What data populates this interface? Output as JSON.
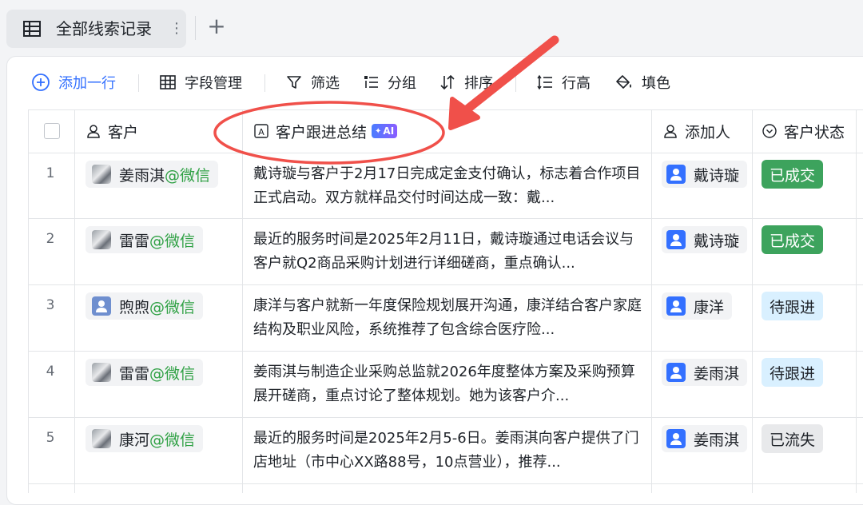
{
  "tab": {
    "label": "全部线索记录",
    "more": "⋮",
    "add": "+"
  },
  "toolbar": {
    "add_row": "添加一行",
    "fields": "字段管理",
    "filter": "筛选",
    "group": "分组",
    "sort": "排序",
    "row_height": "行高",
    "fill": "填色"
  },
  "columns": {
    "customer": "客户",
    "summary": "客户跟进总结",
    "ai_badge": "AI",
    "added_by": "添加人",
    "status": "客户状态"
  },
  "rows": [
    {
      "num": "1",
      "customer": "姜雨淇",
      "channel": "@微信",
      "avatar": "photo",
      "summary": "戴诗璇与客户于2月17日完成定金支付确认，标志着合作项目正式启动。双方就样品交付时间达成一致：戴...",
      "added_by": "戴诗璇",
      "status": "已成交",
      "status_color": "#34a853",
      "status_bg": "#3da35d",
      "status_fg": "#ffffff"
    },
    {
      "num": "2",
      "customer": "雷雷",
      "channel": "@微信",
      "avatar": "photo",
      "summary": "最近的服务时间是2025年2月11日，戴诗璇通过电话会议与客户就Q2商品采购计划进行详细磋商，重点确认...",
      "added_by": "戴诗璇",
      "status": "已成交",
      "status_bg": "#3da35d",
      "status_fg": "#ffffff"
    },
    {
      "num": "3",
      "customer": "煦煦",
      "channel": "@微信",
      "avatar": "user",
      "summary": "康洋与客户就新一年度保险规划展开沟通，康洋结合客户家庭结构及职业风险，系统推荐了包含综合医疗险...",
      "added_by": "康洋",
      "status": "待跟进",
      "status_bg": "#d9f0ff",
      "status_fg": "#1f2329"
    },
    {
      "num": "4",
      "customer": "雷雷",
      "channel": "@微信",
      "avatar": "photo",
      "summary": "姜雨淇与制造企业采购总监就2026年度整体方案及采购预算展开磋商，重点讨论了整体规划。她为该客户介...",
      "added_by": "姜雨淇",
      "status": "待跟进",
      "status_bg": "#d9f0ff",
      "status_fg": "#1f2329"
    },
    {
      "num": "5",
      "customer": "康河",
      "channel": "@微信",
      "avatar": "photo",
      "summary": "最近的服务时间是2025年2月5-6日。姜雨淇向客户提供了门店地址（市中心XX路88号，10点营业），推荐...",
      "added_by": "姜雨淇",
      "status": "已流失",
      "status_bg": "#e8e9eb",
      "status_fg": "#1f2329"
    }
  ],
  "annotation": {
    "color": "#f0504a"
  }
}
